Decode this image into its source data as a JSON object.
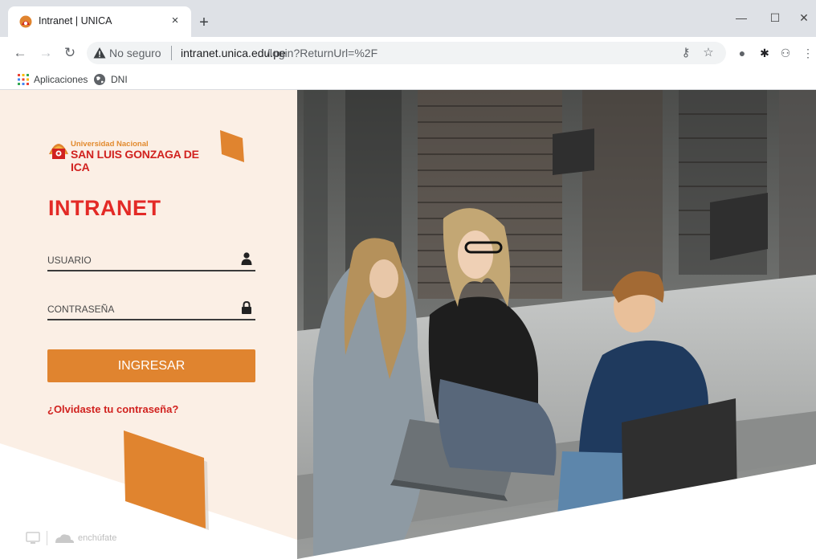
{
  "browser": {
    "tab_title": "Intranet | UNICA",
    "new_tab_symbol": "+",
    "close_symbol": "×",
    "window_minimize": "—",
    "window_maximize": "☐",
    "window_close": "✕",
    "security_label": "No seguro",
    "url_host": "intranet.unica.edu.pe",
    "url_path": "/login?ReturnUrl=%2F",
    "bookmarks": [
      {
        "label": "Aplicaciones",
        "icon": "apps-grid-icon"
      },
      {
        "label": "DNI",
        "icon": "globe-icon"
      }
    ]
  },
  "logo": {
    "line1": "Universidad Nacional",
    "line2": "SAN LUIS GONZAGA DE ICA"
  },
  "login": {
    "title": "INTRANET",
    "username_placeholder": "USUARIO",
    "password_placeholder": "CONTRASEÑA",
    "submit_label": "INGRESAR",
    "forgot_link": "¿Olvidaste tu contraseña?"
  },
  "footer": {
    "brand": "enchúfate"
  },
  "colors": {
    "accent_orange": "#e0842f",
    "brand_red": "#e32a26",
    "panel_bg": "#fbefe5",
    "dark_block": "#2f2f2f"
  }
}
